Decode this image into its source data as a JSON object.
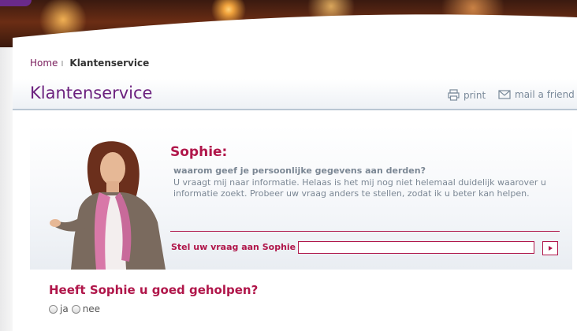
{
  "breadcrumb": {
    "home": "Home",
    "separator": "I",
    "current": "Klantenservice"
  },
  "header": {
    "title": "Klantenservice",
    "print_label": "print",
    "mail_label": "mail a friend"
  },
  "agent": {
    "name": "Sophie:",
    "question": "waarom geef je persoonlijke gegevens aan derden?",
    "answer": "U vraagt mij naar informatie. Helaas is het mij nog niet helemaal duidelijk waarover u informatie zoekt. Probeer uw vraag anders te stellen, zodat ik u beter kan helpen."
  },
  "ask": {
    "label": "Stel uw vraag aan Sophie",
    "value": "",
    "placeholder": ""
  },
  "feedback": {
    "question": "Heeft Sophie u goed geholpen?",
    "yes": "ja",
    "no": "nee"
  },
  "icons": {
    "print": "printer-icon",
    "mail": "envelope-icon",
    "submit": "play-arrow-icon"
  },
  "colors": {
    "accent": "#b0164a",
    "title": "#6a1f7d",
    "muted": "#7b8794"
  }
}
